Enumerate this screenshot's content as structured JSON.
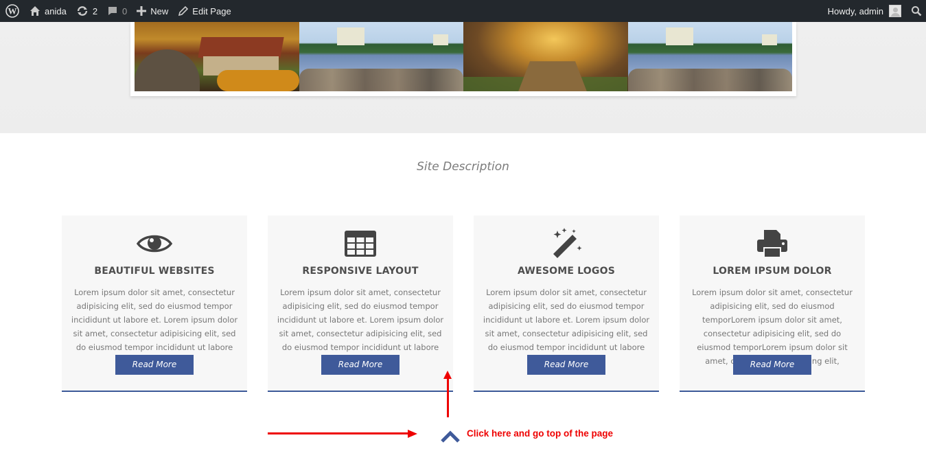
{
  "adminbar": {
    "wp_icon": "wordpress-icon",
    "site_name": "anida",
    "home_icon": "home-icon",
    "updates_icon": "updates-icon",
    "updates_count": "2",
    "comments_icon": "comment-icon",
    "comments_count": "0",
    "new_icon": "plus-icon",
    "new_label": "New",
    "edit_icon": "pencil-icon",
    "edit_label": "Edit Page",
    "greeting": "Howdy, admin",
    "search_icon": "search-icon"
  },
  "site_description": "Site Description",
  "features": [
    {
      "icon": "eye-icon",
      "title": "BEAUTIFUL WEBSITES",
      "text": "Lorem ipsum dolor sit amet, consectetur adipisicing elit, sed do eiusmod tempor incididunt ut labore et. Lorem ipsum dolor sit amet, consectetur adipisicing elit, sed do eiusmod tempor incididunt ut labore",
      "button": "Read More"
    },
    {
      "icon": "table-icon",
      "title": "RESPONSIVE LAYOUT",
      "text": "Lorem ipsum dolor sit amet, consectetur adipisicing elit, sed do eiusmod tempor incididunt ut labore et. Lorem ipsum dolor sit amet, consectetur adipisicing elit, sed do eiusmod tempor incididunt ut labore",
      "button": "Read More"
    },
    {
      "icon": "magic-wand-icon",
      "title": "AWESOME LOGOS",
      "text": "Lorem ipsum dolor sit amet, consectetur adipisicing elit, sed do eiusmod tempor incididunt ut labore et. Lorem ipsum dolor sit amet, consectetur adipisicing elit, sed do eiusmod tempor incididunt ut labore",
      "button": "Read More"
    },
    {
      "icon": "printer-icon",
      "title": "LOREM IPSUM DOLOR",
      "text": "Lorem ipsum dolor sit amet, consectetur adipisicing elit, sed do eiusmod temporLorem ipsum dolor sit amet, consectetur adipisicing elit, sed do eiusmod temporLorem ipsum dolor sit amet, consectetur adipisicing elit,",
      "button": "Read More"
    }
  ],
  "annotation": {
    "text": "Click here and go top of the page",
    "color": "#ee0000"
  },
  "scroll_top_icon": "chevron-up-icon",
  "colors": {
    "adminbar": "#23282d",
    "accent": "#3f5a9a",
    "card_bg": "#f7f7f7"
  }
}
